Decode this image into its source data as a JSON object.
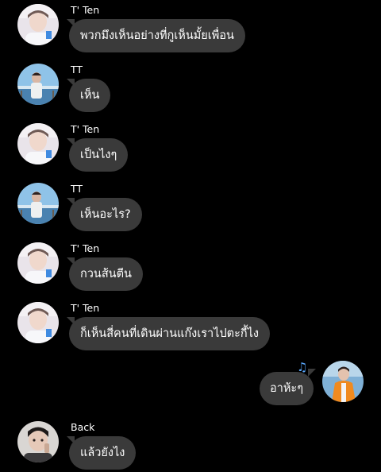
{
  "messages": [
    {
      "sender": "T' Ten",
      "text": "พวกมึงเห็นอย่างที่กูเห็นมั้ยเพื่อน",
      "avatar": "ten-avatar"
    },
    {
      "sender": "TT",
      "text": "เห็น",
      "avatar": "tt-avatar"
    },
    {
      "sender": "T' Ten",
      "text": "เป็นไงๆ",
      "avatar": "ten-avatar"
    },
    {
      "sender": "TT",
      "text": "เห็นอะไร?",
      "avatar": "tt-avatar"
    },
    {
      "sender": "T' Ten",
      "text": "กวนส้นตีน",
      "avatar": "ten-avatar"
    },
    {
      "sender": "T' Ten",
      "text": "ก็เห็นสี่คนที่เดินผ่านแก๊งเราไปตะกี้ไง",
      "avatar": "ten-avatar"
    },
    {
      "sender": "",
      "text": "อาห้ะๆ",
      "avatar": "self-avatar",
      "outgoing": true,
      "icon": "music-note-icon"
    },
    {
      "sender": "Back",
      "text": "แล้วยังไง",
      "avatar": "back-avatar"
    }
  ],
  "colors": {
    "background": "#000000",
    "bubble": "#3a3a3a",
    "text": "#ffffff",
    "music_icon": "#5aa9ff"
  }
}
